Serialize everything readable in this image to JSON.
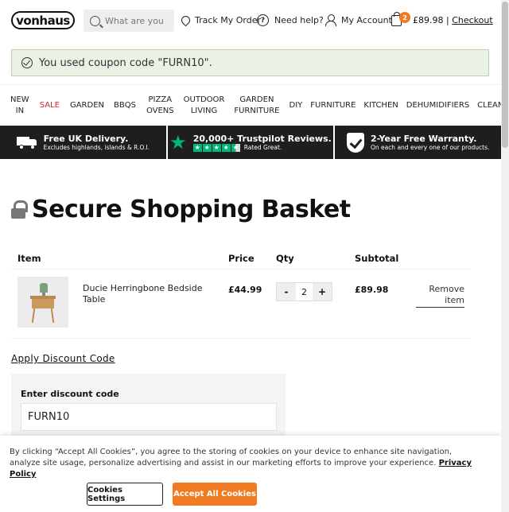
{
  "header": {
    "logo": "vonhaus",
    "search_placeholder": "What are you",
    "track_order": "Track My Order",
    "help": "Need help?",
    "account": "My Account",
    "cart_count": "2",
    "cart_total": "£89.98",
    "separator": "|",
    "checkout": "Checkout"
  },
  "notice": {
    "text": "You used coupon code \"FURN10\"."
  },
  "nav": [
    {
      "line1": "New",
      "line2": "In"
    },
    {
      "line1": "Sale",
      "line2": ""
    },
    {
      "line1": "Garden",
      "line2": ""
    },
    {
      "line1": "BBQs",
      "line2": ""
    },
    {
      "line1": "Pizza",
      "line2": "Ovens"
    },
    {
      "line1": "Outdoor",
      "line2": "Living"
    },
    {
      "line1": "Garden",
      "line2": "Furniture"
    },
    {
      "line1": "DIY",
      "line2": ""
    },
    {
      "line1": "Furniture",
      "line2": ""
    },
    {
      "line1": "Kitchen",
      "line2": ""
    },
    {
      "line1": "Dehumidifiers",
      "line2": ""
    },
    {
      "line1": "Cleaning",
      "line2": ""
    }
  ],
  "usp": [
    {
      "title": "Free UK Delivery.",
      "sub": "Excludes highlands, islands & R.O.I.",
      "icon": "van-icon"
    },
    {
      "title": "20,000+ Trustpilot Reviews.",
      "sub": "Rated Great.",
      "icon": "trustpilot-star-icon",
      "stars": "★"
    },
    {
      "title": "2-Year Free Warranty.",
      "sub": "On each and every one of our products.",
      "icon": "shield-check-icon"
    }
  ],
  "page": {
    "title": "Secure Shopping Basket"
  },
  "table": {
    "headers": {
      "item": "Item",
      "price": "Price",
      "qty": "Qty",
      "subtotal": "Subtotal"
    },
    "rows": [
      {
        "name": "Ducie Herringbone Bedside Table",
        "price": "£44.99",
        "qty": "2",
        "minus": "-",
        "plus": "+",
        "subtotal": "£89.98",
        "remove": "Remove item"
      }
    ]
  },
  "discount": {
    "apply_link": "Apply Discount Code",
    "label": "Enter discount code",
    "value": "FURN10"
  },
  "cookie": {
    "text": "By clicking “Accept All Cookies”, you agree to the storing of cookies on your device to enhance site navigation, analyze site usage, personalize advertising and assist in our marketing efforts to improve your experience.",
    "privacy": "Privacy Policy",
    "settings": "Cookies Settings",
    "accept": "Accept All Cookies"
  },
  "colors": {
    "accent": "#f07b22",
    "sale": "#d2232a",
    "notice_bg": "#e9f2e5",
    "usp_bg": "#1e1e1e",
    "trustpilot": "#00b67a"
  }
}
